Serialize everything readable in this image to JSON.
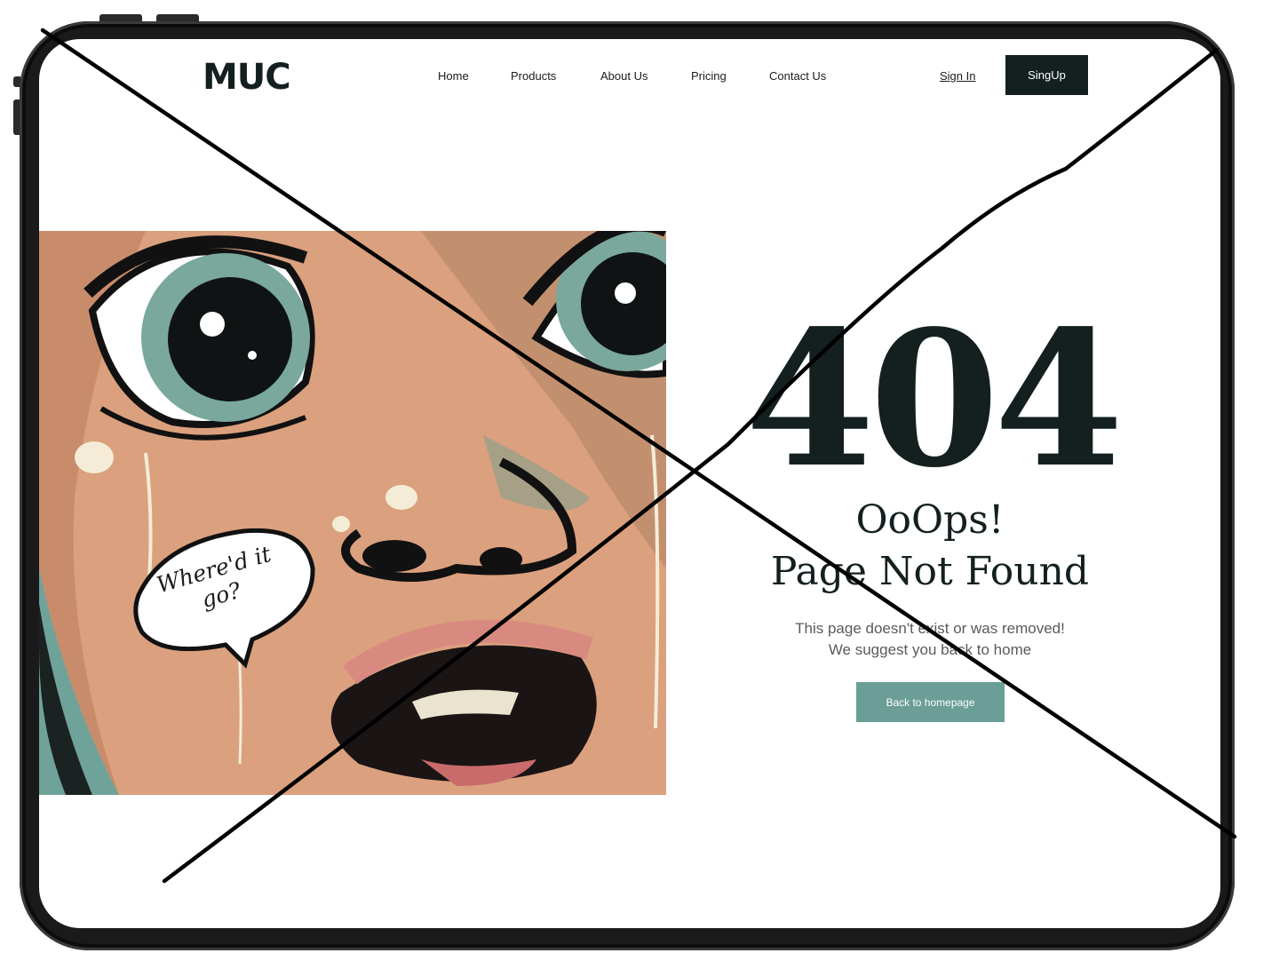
{
  "header": {
    "logo": "MUC",
    "nav": [
      "Home",
      "Products",
      "About Us",
      "Pricing",
      "Contact Us"
    ],
    "sign_in": "Sign In",
    "sign_up": "SingUp"
  },
  "illustration": {
    "speech_bubble": "Where'd it go?"
  },
  "error": {
    "code": "404",
    "title_line1": "OoOps!",
    "title_line2": "Page Not Found",
    "message_line1": "This page doesn't exist or was removed!",
    "message_line2": "We suggest you back to home",
    "button": "Back to homepage"
  },
  "colors": {
    "dark": "#142020",
    "accent": "#6a9e96",
    "skin": "#dba07e"
  }
}
